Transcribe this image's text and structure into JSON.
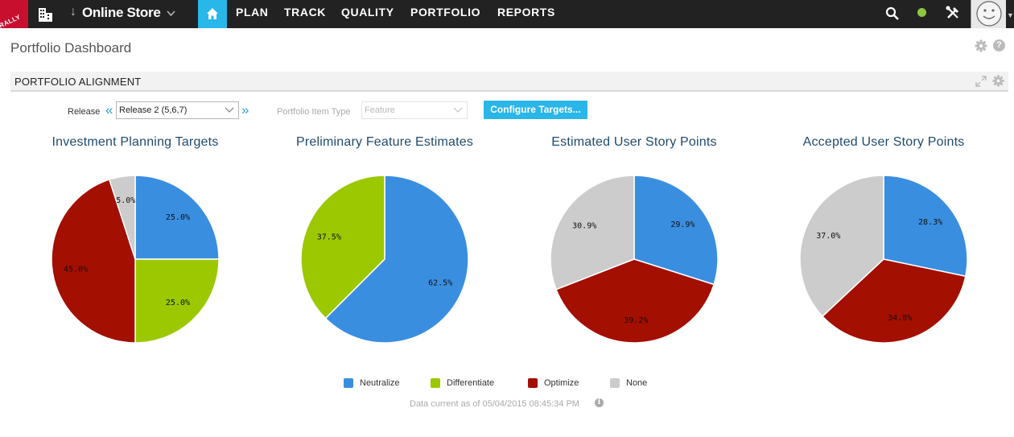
{
  "nav": {
    "logo_text": "RALLY",
    "project_name": "Online Store",
    "items": [
      "PLAN",
      "TRACK",
      "QUALITY",
      "PORTFOLIO",
      "REPORTS"
    ]
  },
  "page": {
    "title": "Portfolio Dashboard"
  },
  "panel": {
    "title": "PORTFOLIO ALIGNMENT",
    "release_label": "Release",
    "release_value": "Release 2 (5,6,7)",
    "portfolio_item_type_label": "Portfolio Item Type",
    "portfolio_item_type_value": "Feature",
    "configure_button": "Configure Targets..."
  },
  "colors": {
    "Neutralize": "#3a8ee0",
    "Differentiate": "#9bc800",
    "Optimize": "#a30f00",
    "None": "#cccccc",
    "accent": "#29b6e8"
  },
  "chart_data": [
    {
      "type": "pie",
      "title": "Investment Planning Targets",
      "slices": [
        {
          "name": "Neutralize",
          "value": 25.0,
          "label": "25.0%"
        },
        {
          "name": "Differentiate",
          "value": 25.0,
          "label": "25.0%"
        },
        {
          "name": "Optimize",
          "value": 45.0,
          "label": "45.0%"
        },
        {
          "name": "None",
          "value": 5.0,
          "label": "5.0%"
        }
      ]
    },
    {
      "type": "pie",
      "title": "Preliminary Feature Estimates",
      "slices": [
        {
          "name": "Neutralize",
          "value": 62.5,
          "label": "62.5%"
        },
        {
          "name": "Differentiate",
          "value": 37.5,
          "label": "37.5%"
        }
      ]
    },
    {
      "type": "pie",
      "title": "Estimated User Story Points",
      "slices": [
        {
          "name": "Neutralize",
          "value": 29.9,
          "label": "29.9%"
        },
        {
          "name": "Optimize",
          "value": 39.2,
          "label": "39.2%"
        },
        {
          "name": "None",
          "value": 30.9,
          "label": "30.9%"
        }
      ]
    },
    {
      "type": "pie",
      "title": "Accepted User Story Points",
      "slices": [
        {
          "name": "Neutralize",
          "value": 28.3,
          "label": "28.3%"
        },
        {
          "name": "Optimize",
          "value": 34.8,
          "label": "34.8%"
        },
        {
          "name": "None",
          "value": 37.0,
          "label": "37.0%"
        }
      ]
    }
  ],
  "legend": [
    "Neutralize",
    "Differentiate",
    "Optimize",
    "None"
  ],
  "footer": {
    "timestamp_text": "Data current as of 05/04/2015 08:45:34 PM"
  }
}
